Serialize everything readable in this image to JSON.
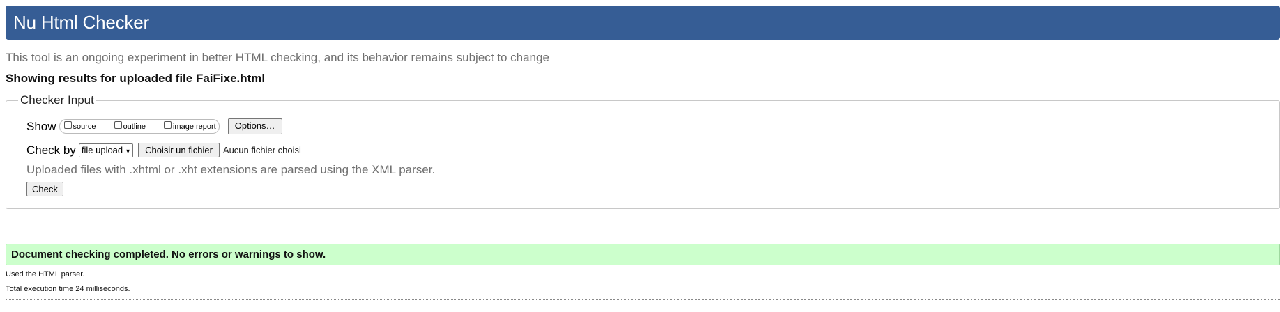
{
  "header": {
    "title": "Nu Html Checker",
    "background_color": "#365d95"
  },
  "disclaimer": "This tool is an ongoing experiment in better HTML checking, and its behavior remains subject to change",
  "results_heading": "Showing results for uploaded file FaiFixe.html",
  "checker_input": {
    "legend": "Checker Input",
    "show_label": "Show",
    "show_options": [
      {
        "label": "source",
        "checked": false
      },
      {
        "label": "outline",
        "checked": false
      },
      {
        "label": "image report",
        "checked": false
      }
    ],
    "options_button": "Options…",
    "check_by_label": "Check by",
    "check_by_selected": "file upload",
    "choose_file_button": "Choisir un fichier",
    "no_file_text": "Aucun fichier choisi",
    "xml_note": "Uploaded files with .xhtml or .xht extensions are parsed using the XML parser.",
    "check_button": "Check"
  },
  "result": {
    "message": "Document checking completed. No errors or warnings to show.",
    "background_color": "#ccffcc"
  },
  "stats": {
    "parser": "Used the HTML parser.",
    "execution_time": "Total execution time 24 milliseconds."
  }
}
